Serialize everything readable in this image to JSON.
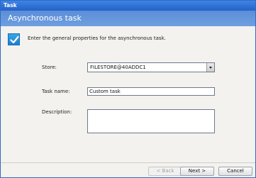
{
  "window": {
    "title": "Task"
  },
  "wizard": {
    "header": "Asynchronous task",
    "intro": "Enter the general properties for the asynchronous task."
  },
  "form": {
    "store": {
      "label": "Store:",
      "value": "FILESTORE@40ADDC1"
    },
    "task_name": {
      "label": "Task name:",
      "value": "Custom task"
    },
    "description": {
      "label": "Description:",
      "value": ""
    }
  },
  "buttons": {
    "back": "< Back",
    "next": "Next >",
    "cancel": "Cancel"
  },
  "icons": {
    "header_icon": "checkmark-icon",
    "store_dropdown": "chevron-down-icon"
  },
  "colors": {
    "titlebar": "#2f6ac8",
    "banner": "#6f9fe0",
    "check_icon": "#2196e3"
  }
}
